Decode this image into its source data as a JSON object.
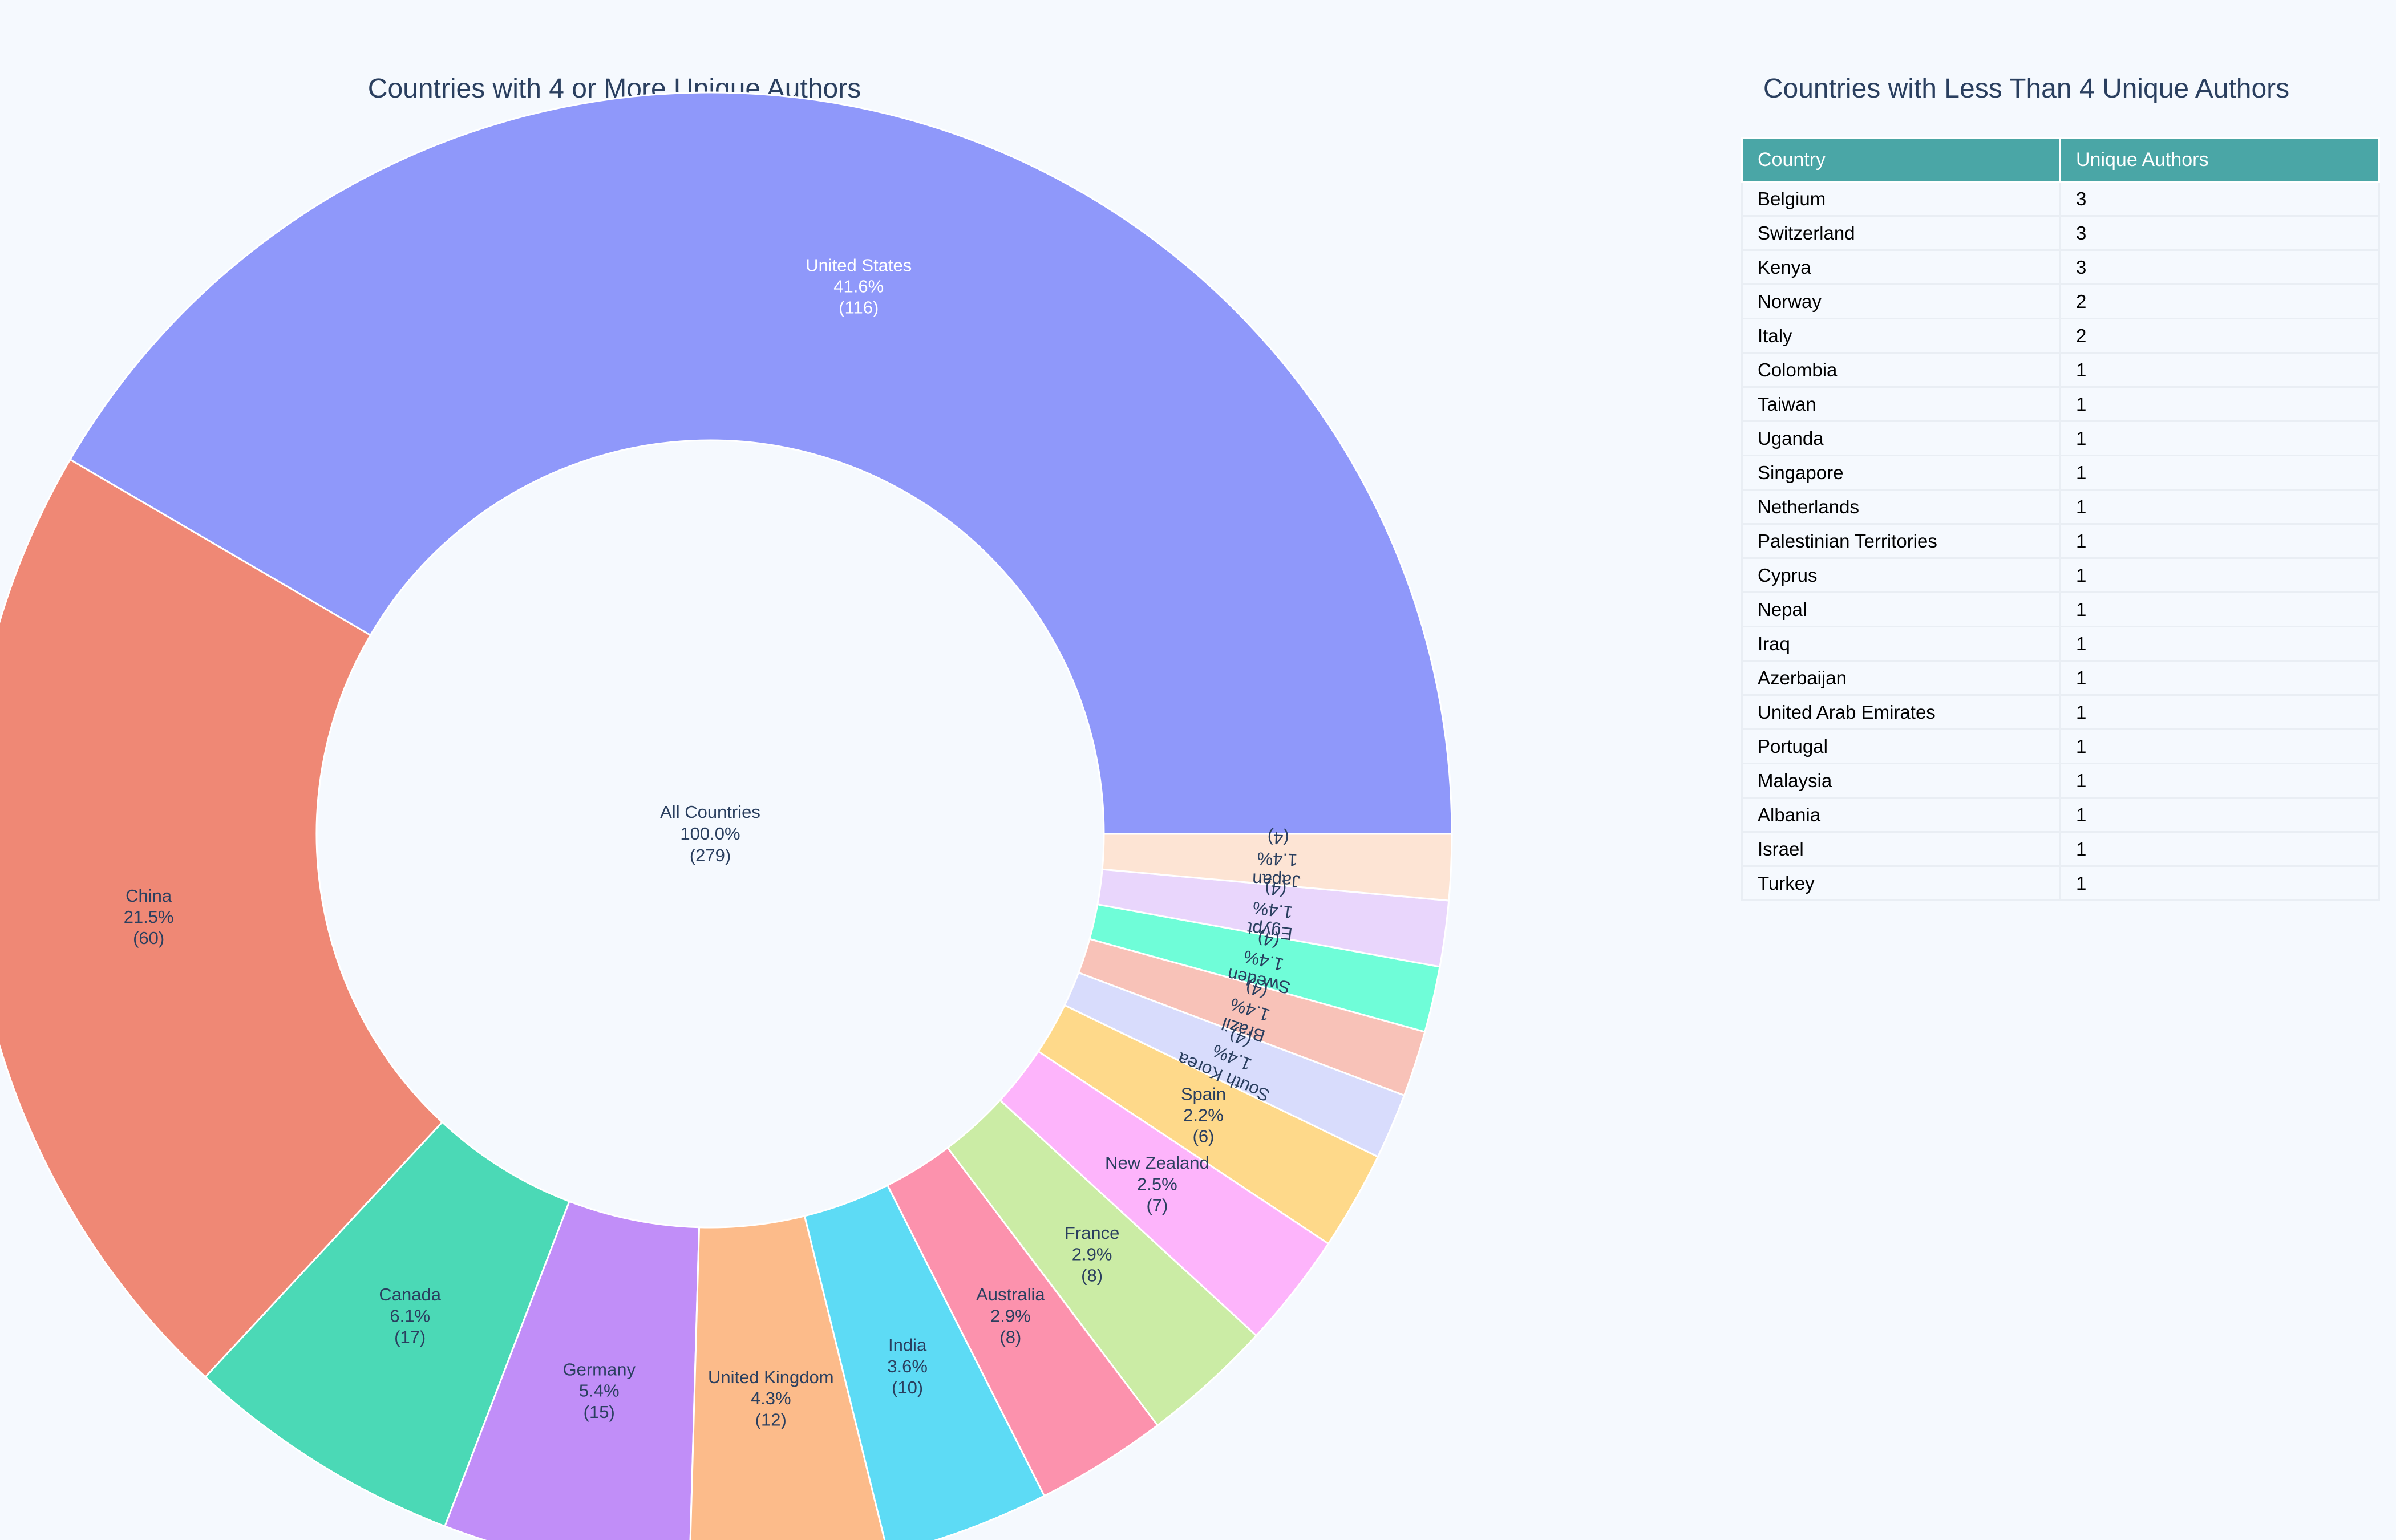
{
  "pie_title": "Countries with 4 or More Unique Authors",
  "table_title": "Countries with Less Than 4 Unique Authors",
  "table": {
    "headers": [
      "Country",
      "Unique Authors"
    ],
    "rows": [
      [
        "Belgium",
        "3"
      ],
      [
        "Switzerland",
        "3"
      ],
      [
        "Kenya",
        "3"
      ],
      [
        "Norway",
        "2"
      ],
      [
        "Italy",
        "2"
      ],
      [
        "Colombia",
        "1"
      ],
      [
        "Taiwan",
        "1"
      ],
      [
        "Uganda",
        "1"
      ],
      [
        "Singapore",
        "1"
      ],
      [
        "Netherlands",
        "1"
      ],
      [
        "Palestinian Territories",
        "1"
      ],
      [
        "Cyprus",
        "1"
      ],
      [
        "Nepal",
        "1"
      ],
      [
        "Iraq",
        "1"
      ],
      [
        "Azerbaijan",
        "1"
      ],
      [
        "United Arab Emirates",
        "1"
      ],
      [
        "Portugal",
        "1"
      ],
      [
        "Malaysia",
        "1"
      ],
      [
        "Albania",
        "1"
      ],
      [
        "Israel",
        "1"
      ],
      [
        "Turkey",
        "1"
      ]
    ]
  },
  "chart_data": [
    {
      "type": "pie",
      "subtype": "sunburst",
      "title": "Countries with 4 or More Unique Authors",
      "root": {
        "label": "All Countries",
        "percent": "100.0%",
        "count": "(279)"
      },
      "slices": [
        {
          "label": "United States",
          "value": 116,
          "percent": "41.6%",
          "color": "#8f98fa",
          "text_color": "#ffffff"
        },
        {
          "label": "China",
          "value": 60,
          "percent": "21.5%",
          "color": "#ef8875",
          "text_color": "#2a3f5f"
        },
        {
          "label": "Canada",
          "value": 17,
          "percent": "6.1%",
          "color": "#4bd9b6",
          "text_color": "#2a3f5f"
        },
        {
          "label": "Germany",
          "value": 15,
          "percent": "5.4%",
          "color": "#c18ef8",
          "text_color": "#2a3f5f"
        },
        {
          "label": "United Kingdom",
          "value": 12,
          "percent": "4.3%",
          "color": "#fcbb8a",
          "text_color": "#2a3f5f"
        },
        {
          "label": "India",
          "value": 10,
          "percent": "3.6%",
          "color": "#5ddbf5",
          "text_color": "#2a3f5f"
        },
        {
          "label": "Australia",
          "value": 8,
          "percent": "2.9%",
          "color": "#fc92ad",
          "text_color": "#2a3f5f"
        },
        {
          "label": "France",
          "value": 8,
          "percent": "2.9%",
          "color": "#cbeca5",
          "text_color": "#2a3f5f"
        },
        {
          "label": "New Zealand",
          "value": 7,
          "percent": "2.5%",
          "color": "#fdb4fb",
          "text_color": "#2a3f5f"
        },
        {
          "label": "Spain",
          "value": 6,
          "percent": "2.2%",
          "color": "#fed98a",
          "text_color": "#2a3f5f"
        },
        {
          "label": "South Korea",
          "value": 4,
          "percent": "1.4%",
          "color": "#d8dcfc",
          "text_color": "#2a3f5f"
        },
        {
          "label": "Brazil",
          "value": 4,
          "percent": "1.4%",
          "color": "#f8c2b8",
          "text_color": "#2a3f5f"
        },
        {
          "label": "Sweden",
          "value": 4,
          "percent": "1.4%",
          "color": "#6ffdd8",
          "text_color": "#2a3f5f"
        },
        {
          "label": "Egypt",
          "value": 4,
          "percent": "1.4%",
          "color": "#e9d6fc",
          "text_color": "#2a3f5f"
        },
        {
          "label": "Japan",
          "value": 4,
          "percent": "1.4%",
          "color": "#fde4d4",
          "text_color": "#2a3f5f"
        }
      ],
      "total": 279
    },
    {
      "type": "table",
      "title": "Countries with Less Than 4 Unique Authors",
      "columns": [
        "Country",
        "Unique Authors"
      ]
    }
  ]
}
